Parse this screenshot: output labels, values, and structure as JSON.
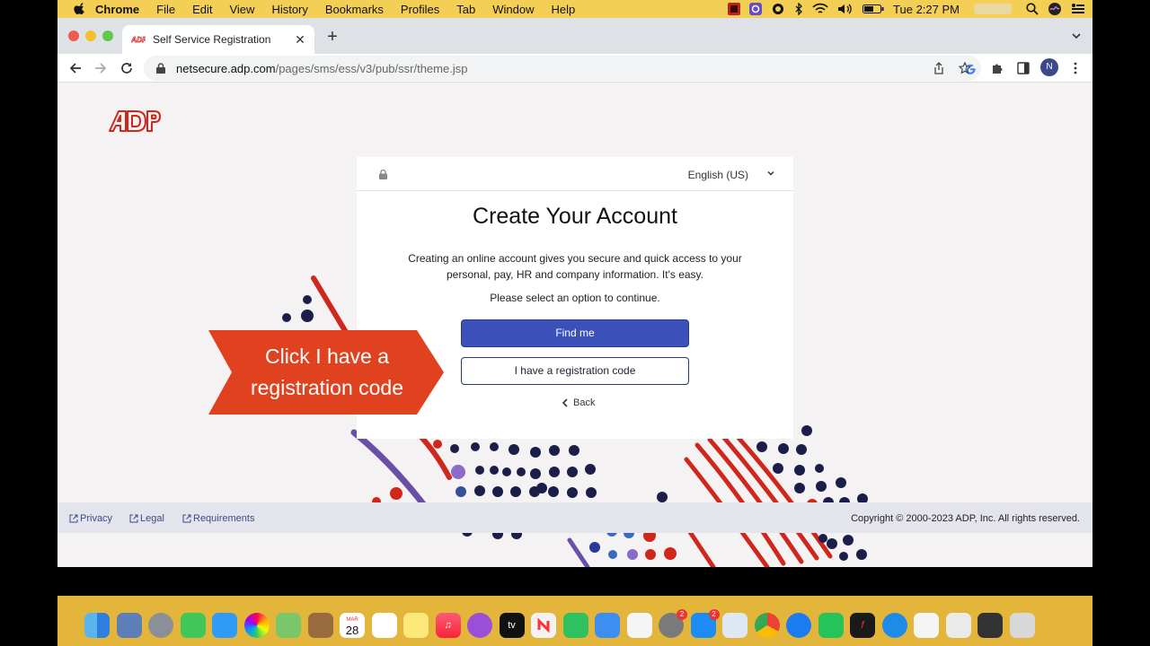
{
  "menubar": {
    "app_name": "Chrome",
    "items": [
      "File",
      "Edit",
      "View",
      "History",
      "Bookmarks",
      "Profiles",
      "Tab",
      "Window",
      "Help"
    ],
    "clock": "Tue 2:27 PM"
  },
  "browser": {
    "tab_title": "Self Service Registration",
    "url_host": "netsecure.adp.com",
    "url_path": "/pages/sms/ess/v3/pub/ssr/theme.jsp",
    "profile_initial": "N"
  },
  "card": {
    "language": "English (US)",
    "title": "Create Your Account",
    "description": "Creating an online account gives you secure and quick access to your personal, pay, HR and company information. It's easy.",
    "prompt": "Please select an option to continue.",
    "find_me_label": "Find me",
    "registration_code_label": "I have a registration code",
    "back_label": "Back"
  },
  "callout": {
    "line1": "Click I have a",
    "line2": "registration code"
  },
  "footer": {
    "privacy": "Privacy",
    "legal": "Legal",
    "requirements": "Requirements",
    "copyright": "Copyright © 2000-2023 ADP, Inc. All rights reserved."
  },
  "dock": {
    "calendar_day": "28",
    "calendar_month": "MAR",
    "tv_label": "tv",
    "app_store_badge": "2",
    "settings_badge": "2"
  },
  "colors": {
    "menubar": "#f3cf55",
    "adp_red": "#d0271d",
    "primary_button": "#3c50b9",
    "callout_red": "#e0421f",
    "navy_dot": "#1c1e4a"
  }
}
